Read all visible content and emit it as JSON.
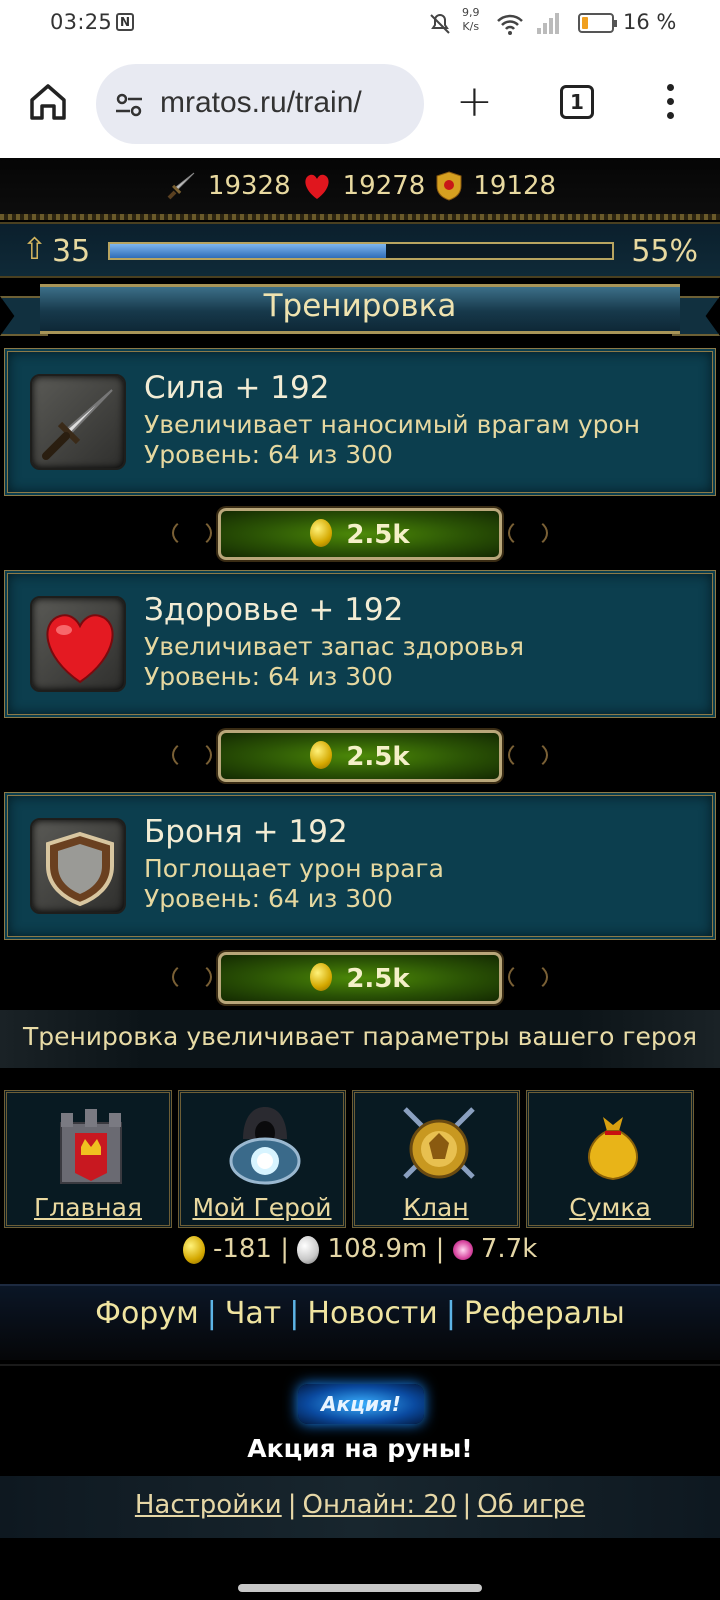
{
  "status_bar": {
    "time": "03:25",
    "net_speed_value": "9,9",
    "net_speed_unit": "K/s",
    "battery": "16 %"
  },
  "browser": {
    "url": "mratos.ru/train/",
    "tab_count": "1"
  },
  "stats": {
    "attack": "19328",
    "health": "19278",
    "defense": "19128"
  },
  "level": {
    "value": "35",
    "percent_label": "55%",
    "progress": 0.55
  },
  "page_title": "Тренировка",
  "trainings": [
    {
      "name": "Сила + 192",
      "description": "Увеличивает наносимый врагам урон",
      "level": "Уровень: 64 из 300",
      "icon": "sword-icon",
      "price": "2.5k"
    },
    {
      "name": "Здоровье + 192",
      "description": "Увеличивает запас здоровья",
      "level": "Уровень: 64 из 300",
      "icon": "heart-icon",
      "price": "2.5k"
    },
    {
      "name": "Броня + 192",
      "description": "Поглощает урон врага",
      "level": "Уровень: 64 из 300",
      "icon": "shield-icon",
      "price": "2.5k"
    }
  ],
  "info_text": "Тренировка увеличивает параметры вашего героя",
  "nav": [
    {
      "label": "Главная",
      "icon": "castle-icon"
    },
    {
      "label": "Мой Герой",
      "icon": "hero-icon"
    },
    {
      "label": "Клан",
      "icon": "dragon-emblem-icon"
    },
    {
      "label": "Сумка",
      "icon": "bag-icon"
    }
  ],
  "currency": {
    "gold": "-181",
    "silver": "108.9m",
    "gems": "7.7k"
  },
  "links": [
    "Форум",
    "Чат",
    "Новости",
    "Рефералы"
  ],
  "promo": {
    "badge": "Акция!",
    "text": "Акция на руны!"
  },
  "footer": {
    "settings": "Настройки",
    "online": "Онлайн: 20",
    "about": "Об игре"
  },
  "colors": {
    "gold_text": "#e8d9a0",
    "card_bg": "#0c3e4e",
    "button_green": "#4d8a08",
    "xp_blue": "#2f6db8",
    "link_separator": "#5db4e6"
  }
}
